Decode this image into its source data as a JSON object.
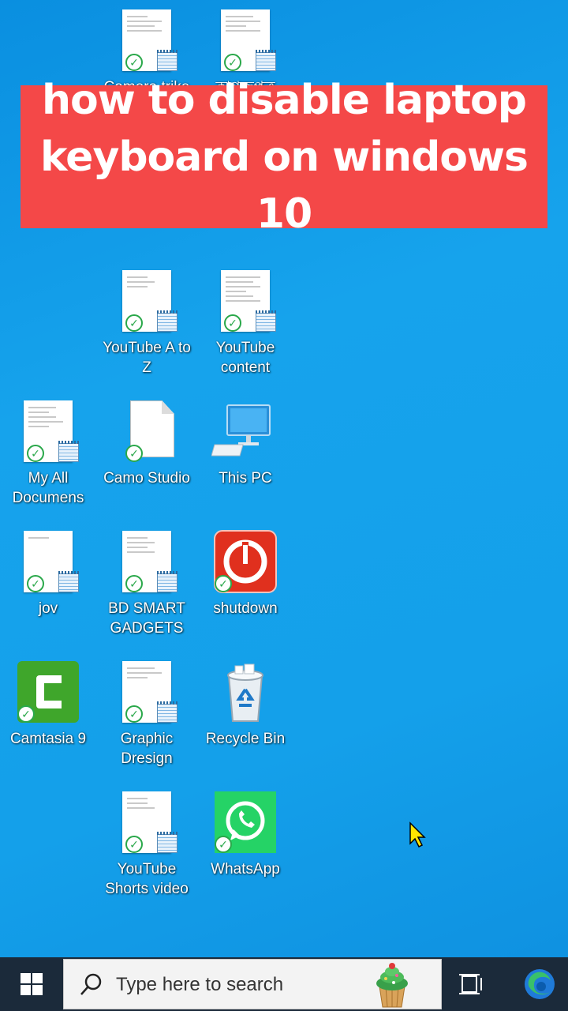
{
  "banner": {
    "title": "how to disable laptop keyboard on windows 10"
  },
  "desktop_icons": [
    {
      "label": "Camera trike",
      "type": "document"
    },
    {
      "label": "কাগজপত্র",
      "type": "document"
    },
    {
      "label": "YouTube A to Z",
      "type": "document"
    },
    {
      "label": "YouTube content",
      "type": "document"
    },
    {
      "label": "My All Documens",
      "type": "document"
    },
    {
      "label": "Camo Studio",
      "type": "blank-file"
    },
    {
      "label": "This PC",
      "type": "computer"
    },
    {
      "label": "jov",
      "type": "document"
    },
    {
      "label": "BD SMART GADGETS",
      "type": "document"
    },
    {
      "label": "shutdown",
      "type": "power"
    },
    {
      "label": "Camtasia 9",
      "type": "camtasia"
    },
    {
      "label": "Graphic Dresign",
      "type": "document"
    },
    {
      "label": "Recycle Bin",
      "type": "recycle-bin"
    },
    {
      "label": "YouTube Shorts video",
      "type": "document"
    },
    {
      "label": "WhatsApp",
      "type": "whatsapp"
    }
  ],
  "taskbar": {
    "search_placeholder": "Type here to search",
    "icons": [
      "windows-start-icon",
      "search-icon",
      "cupcake-icon",
      "task-view-icon",
      "edge-icon"
    ]
  },
  "colors": {
    "desktop": "#14a0ea",
    "banner": "#f44848",
    "taskbar": "#1b2a3a"
  }
}
